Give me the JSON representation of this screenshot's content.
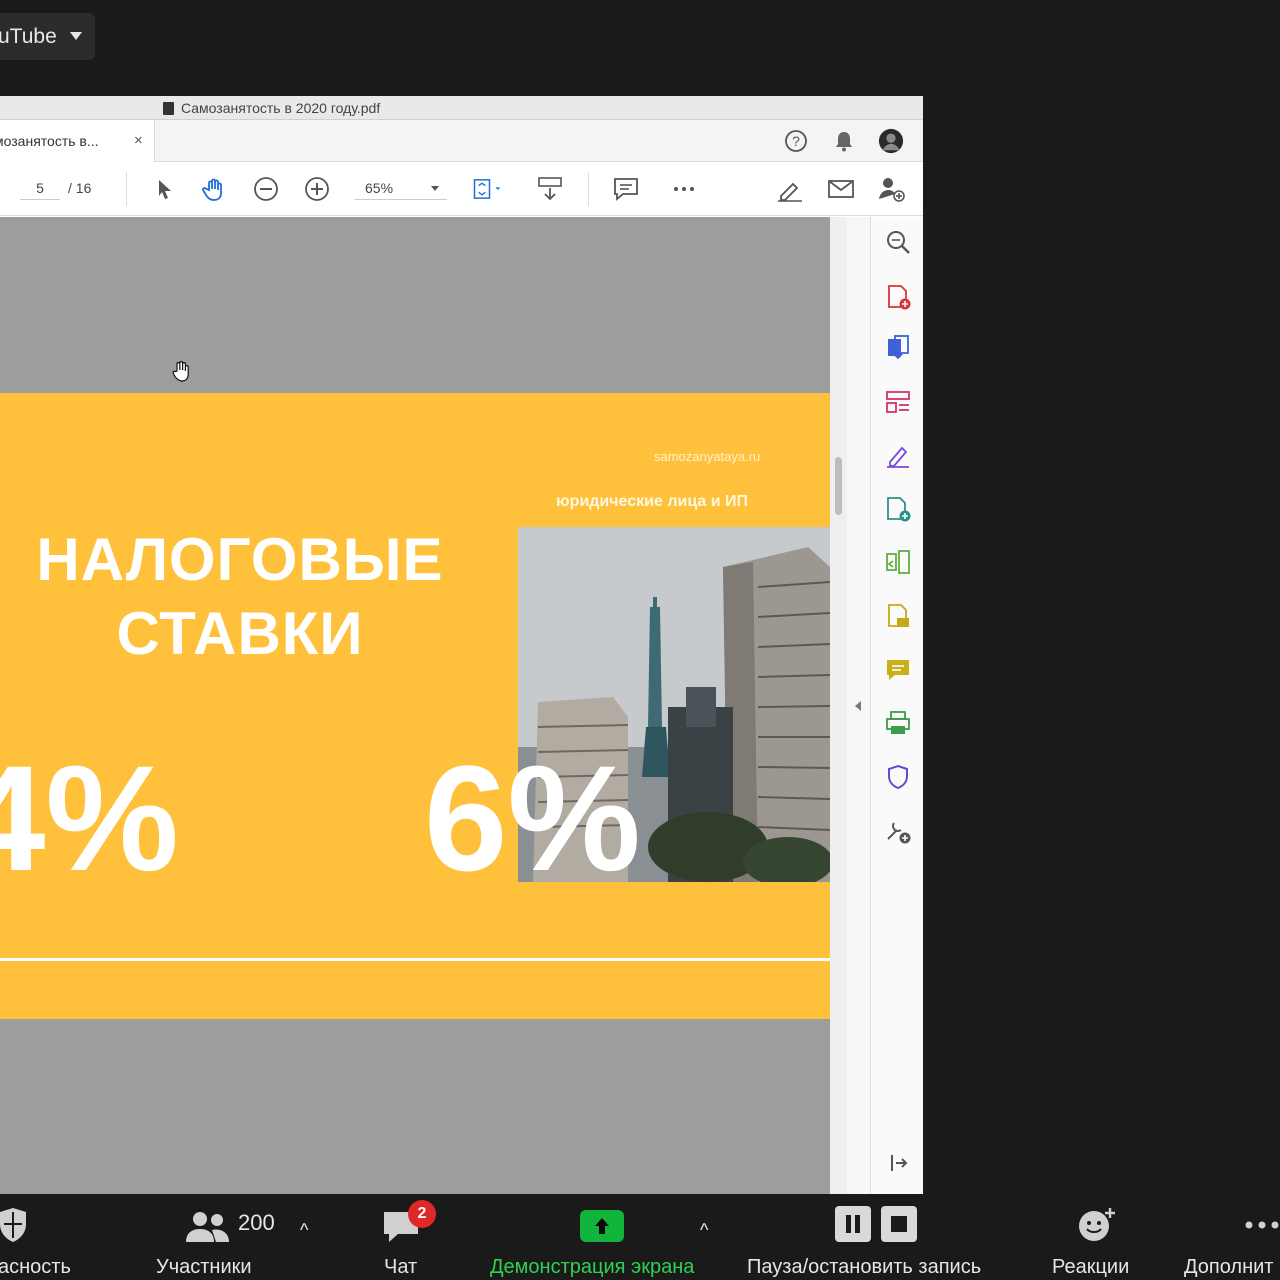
{
  "source_pill": {
    "label": "uTube"
  },
  "acrobat": {
    "window_title": "Самозанятость в 2020 году.pdf",
    "tab_label": "мозанятость в...",
    "tab_close": "×",
    "toolbar": {
      "page_current": "5",
      "page_total": "/  16",
      "zoom": "65%"
    }
  },
  "slide": {
    "site": "samozanyataya.ru",
    "subtitle": "юридические лица и ИП",
    "title_line1": "НАЛОГОВЫЕ",
    "title_line2": "СТАВКИ",
    "percent_left": "4%",
    "percent_right": "6%"
  },
  "zoom_bar": {
    "security_label": "асность",
    "participants_count": "200",
    "participants_label": "Участники",
    "chat_label": "Чат",
    "chat_badge": "2",
    "share_label": "Демонстрация экрана",
    "record_label": "Пауза/остановить запись",
    "reactions_label": "Реакции",
    "more_label": "Дополнит"
  },
  "colors": {
    "slide_bg": "#ffc13b",
    "doc_bg": "#9d9d9d",
    "share_green": "#12b43b",
    "badge_red": "#e02828"
  }
}
